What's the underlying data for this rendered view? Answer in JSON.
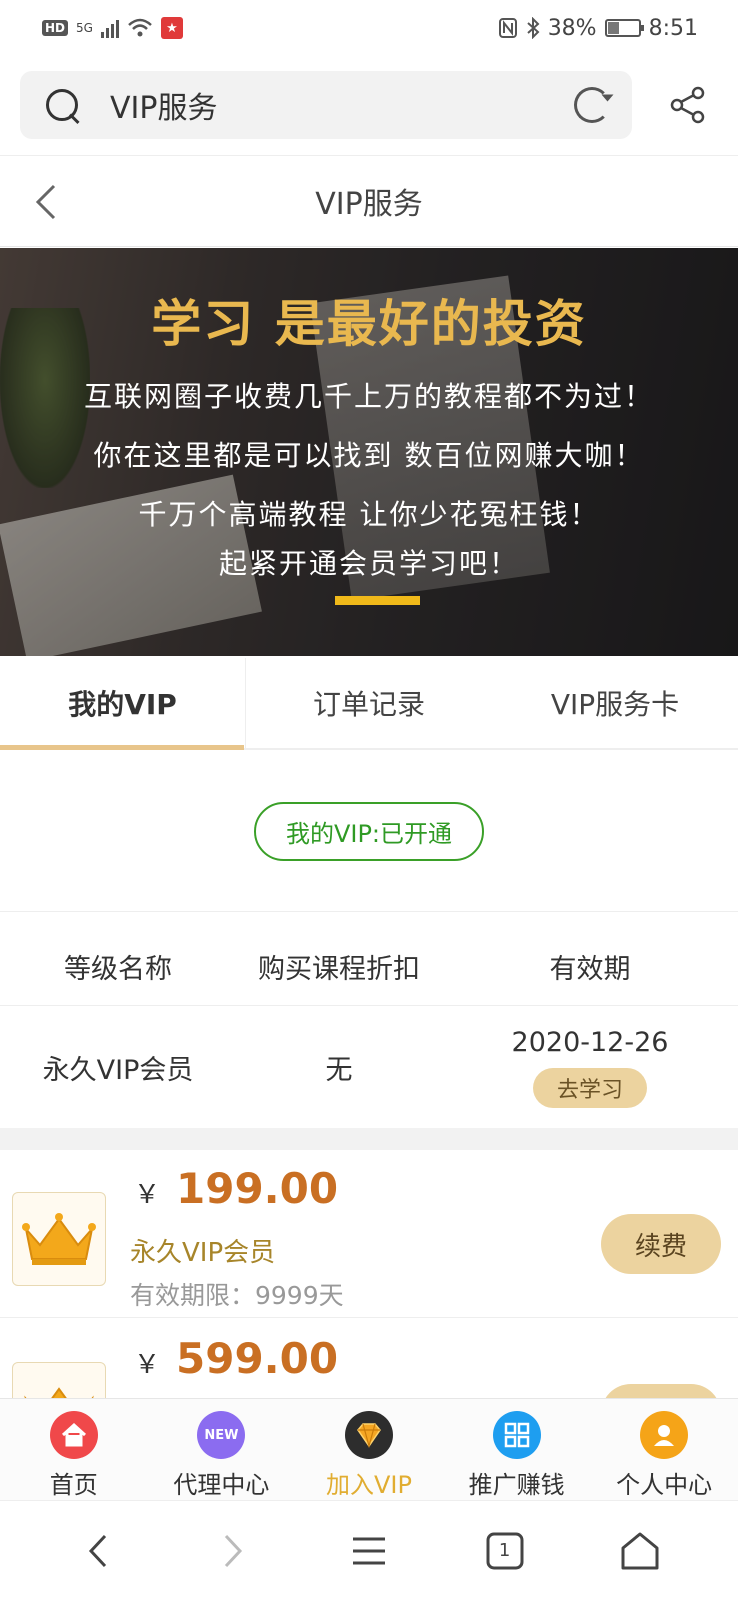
{
  "status_bar": {
    "hd": "HD",
    "network": "5G",
    "battery_percent_text": "38%",
    "battery_level": 0.38,
    "time": "8:51"
  },
  "search": {
    "query": "VIP服务"
  },
  "header": {
    "title": "VIP服务"
  },
  "banner": {
    "headline": "学习 是最好的投资",
    "lines": [
      "互联网圈子收费几千上万的教程都不为过！",
      "你在这里都是可以找到 数百位网赚大咖！",
      "千万个高端教程 让你少花冤枉钱！",
      "起紧开通会员学习吧！"
    ]
  },
  "tabs": [
    {
      "label": "我的VIP",
      "active": true
    },
    {
      "label": "订单记录",
      "active": false
    },
    {
      "label": "VIP服务卡",
      "active": false
    }
  ],
  "vip_status": "我的VIP:已开通",
  "level_table": {
    "headers": [
      "等级名称",
      "购买课程折扣",
      "有效期"
    ],
    "row": {
      "name": "永久VIP会员",
      "discount": "无",
      "expiry": "2020-12-26",
      "action": "去学习"
    }
  },
  "products": [
    {
      "currency": "￥",
      "price": "199.00",
      "name": "永久VIP会员",
      "validity": "有效期限：9999天",
      "action": "续费"
    },
    {
      "currency": "￥",
      "price": "599.00",
      "name": "",
      "validity": "",
      "action": ""
    }
  ],
  "bottom_nav": [
    {
      "label": "首页",
      "icon": "home-icon",
      "color": "#f0484a"
    },
    {
      "label": "代理中心",
      "icon": "new-badge-icon",
      "color": "#8b6cf0",
      "badge": "NEW"
    },
    {
      "label": "加入VIP",
      "icon": "diamond-icon",
      "color": "#2d2d2d",
      "active": true
    },
    {
      "label": "推广赚钱",
      "icon": "grid-icon",
      "color": "#1e9ef0"
    },
    {
      "label": "个人中心",
      "icon": "person-icon",
      "color": "#f5a418"
    }
  ],
  "system_nav": {
    "tab_count": "1"
  },
  "colors": {
    "accent_gold": "#e8c58b",
    "price_orange": "#c96f23",
    "vip_green": "#2f9a24",
    "banner_gold": "#e9b84f"
  }
}
